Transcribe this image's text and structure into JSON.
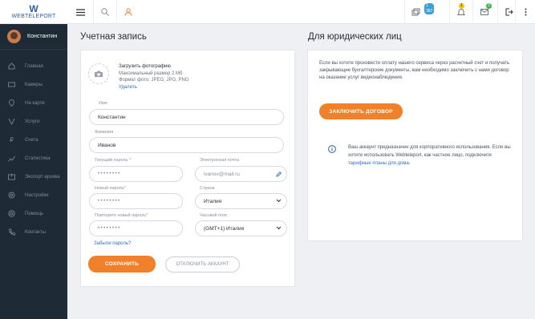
{
  "brand": {
    "logo_mark": "W",
    "logo_text": "WEBTELEPORT"
  },
  "topbar": {
    "menu_icon": "menu-icon",
    "search_icon": "search-icon",
    "user_icon": "user-icon",
    "cam_badge": "1 367",
    "bell_badge": "1",
    "mail_badge": "3"
  },
  "sidebar": {
    "user_name": "Константин",
    "items": [
      {
        "label": "Главная",
        "icon": "home-icon"
      },
      {
        "label": "Камеры",
        "icon": "camera-icon"
      },
      {
        "label": "На карте",
        "icon": "map-pin-icon"
      },
      {
        "label": "Услуги",
        "icon": "services-icon"
      },
      {
        "label": "Счета",
        "icon": "ruble-icon"
      },
      {
        "label": "Статистика",
        "icon": "chart-icon"
      },
      {
        "label": "Экспорт архива",
        "icon": "export-icon"
      },
      {
        "label": "Настройки",
        "icon": "gear-icon"
      },
      {
        "label": "Помощь",
        "icon": "help-icon"
      },
      {
        "label": "Контакты",
        "icon": "phone-icon"
      }
    ]
  },
  "account": {
    "title": "Учетная запись",
    "photo": {
      "upload": "Загрузить фотографию",
      "max_size": "Максимальный размер 2 Мб",
      "formats": "Формат фото: JPEG, JPG, PNG",
      "delete": "Удалить"
    },
    "name_label": "Имя",
    "name_value": "Константин",
    "surname_label": "Фамилия",
    "surname_value": "Иванов",
    "current_pw_label": "Текущий пароль",
    "current_pw_value": "••••••••",
    "new_pw_label": "Новый пароль",
    "new_pw_value": "••••••••",
    "repeat_pw_label": "Повторите новый пароль",
    "repeat_pw_value": "••••••••",
    "email_label": "Электронная почта",
    "email_value": "ivanov@mail.ru",
    "country_label": "Страна",
    "country_value": "Италия",
    "tz_label": "Часовой пояс",
    "tz_value": "(GMT+1) Италия",
    "forgot": "Забыли пароль?",
    "save": "СОХРАНИТЬ",
    "disable": "ОТКЛЮЧИТЬ АККАУНТ"
  },
  "legal": {
    "title": "Для юридических лиц",
    "text": "Если вы хотите произвести оплату нашего сервиса через расчетный счет и получать закрывающие бухгалтерские документы, вам необходимо заключить с нами договор на оказание услуг видеонаблюдения.",
    "button": "ЗАКЛЮЧИТЬ ДОГОВОР",
    "info_text": "Ваш аккаунт предназначен для корпоративного использования. Если вы хотите использовать Webteleport, как частное лицо, подключите",
    "info_link": "тарифные планы для дома."
  },
  "colors": {
    "accent": "#f0802a",
    "sidebar": "#1e2a35",
    "link": "#2e6fc4"
  }
}
